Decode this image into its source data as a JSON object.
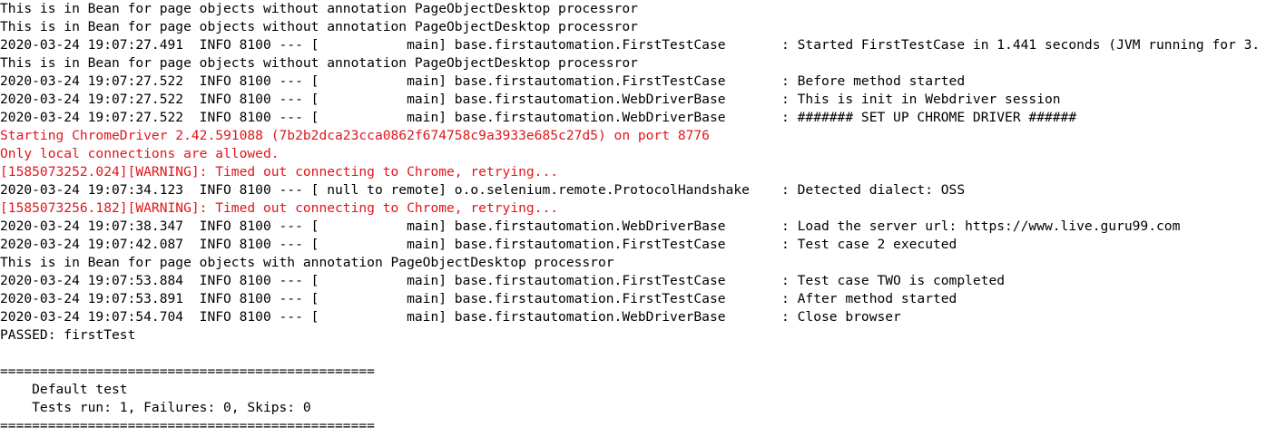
{
  "console": {
    "lines": [
      {
        "text": "This is in Bean for page objects without annotation PageObjectDesktop processror",
        "stream": "stdout"
      },
      {
        "text": "This is in Bean for page objects without annotation PageObjectDesktop processror",
        "stream": "stdout"
      },
      {
        "text": "2020-03-24 19:07:27.491  INFO 8100 --- [           main] base.firstautomation.FirstTestCase       : Started FirstTestCase in 1.441 seconds (JVM running for 3.",
        "stream": "stdout"
      },
      {
        "text": "This is in Bean for page objects without annotation PageObjectDesktop processror",
        "stream": "stdout"
      },
      {
        "text": "2020-03-24 19:07:27.522  INFO 8100 --- [           main] base.firstautomation.FirstTestCase       : Before method started",
        "stream": "stdout"
      },
      {
        "text": "2020-03-24 19:07:27.522  INFO 8100 --- [           main] base.firstautomation.WebDriverBase       : This is init in Webdriver session",
        "stream": "stdout"
      },
      {
        "text": "2020-03-24 19:07:27.522  INFO 8100 --- [           main] base.firstautomation.WebDriverBase       : ####### SET UP CHROME DRIVER ######",
        "stream": "stdout"
      },
      {
        "text": "Starting ChromeDriver 2.42.591088 (7b2b2dca23cca0862f674758c9a3933e685c27d5) on port 8776",
        "stream": "stderr"
      },
      {
        "text": "Only local connections are allowed.",
        "stream": "stderr"
      },
      {
        "text": "[1585073252.024][WARNING]: Timed out connecting to Chrome, retrying...",
        "stream": "stderr"
      },
      {
        "text": "2020-03-24 19:07:34.123  INFO 8100 --- [ null to remote] o.o.selenium.remote.ProtocolHandshake    : Detected dialect: OSS",
        "stream": "stdout"
      },
      {
        "text": "[1585073256.182][WARNING]: Timed out connecting to Chrome, retrying...",
        "stream": "stderr"
      },
      {
        "text": "2020-03-24 19:07:38.347  INFO 8100 --- [           main] base.firstautomation.WebDriverBase       : Load the server url: https://www.live.guru99.com",
        "stream": "stdout"
      },
      {
        "text": "2020-03-24 19:07:42.087  INFO 8100 --- [           main] base.firstautomation.FirstTestCase       : Test case 2 executed",
        "stream": "stdout"
      },
      {
        "text": "This is in Bean for page objects with annotation PageObjectDesktop processror",
        "stream": "stdout"
      },
      {
        "text": "2020-03-24 19:07:53.884  INFO 8100 --- [           main] base.firstautomation.FirstTestCase       : Test case TWO is completed",
        "stream": "stdout"
      },
      {
        "text": "2020-03-24 19:07:53.891  INFO 8100 --- [           main] base.firstautomation.FirstTestCase       : After method started",
        "stream": "stdout"
      },
      {
        "text": "2020-03-24 19:07:54.704  INFO 8100 --- [           main] base.firstautomation.WebDriverBase       : Close browser",
        "stream": "stdout"
      },
      {
        "text": "PASSED: firstTest",
        "stream": "stdout"
      },
      {
        "text": "",
        "stream": "stdout"
      },
      {
        "text": "===============================================",
        "stream": "stdout"
      },
      {
        "text": "    Default test",
        "stream": "stdout"
      },
      {
        "text": "    Tests run: 1, Failures: 0, Skips: 0",
        "stream": "stdout"
      },
      {
        "text": "===============================================",
        "stream": "stdout"
      }
    ]
  },
  "colors": {
    "background": "#ffffff",
    "stdout_text": "#000000",
    "stderr_text": "#e0161b"
  }
}
